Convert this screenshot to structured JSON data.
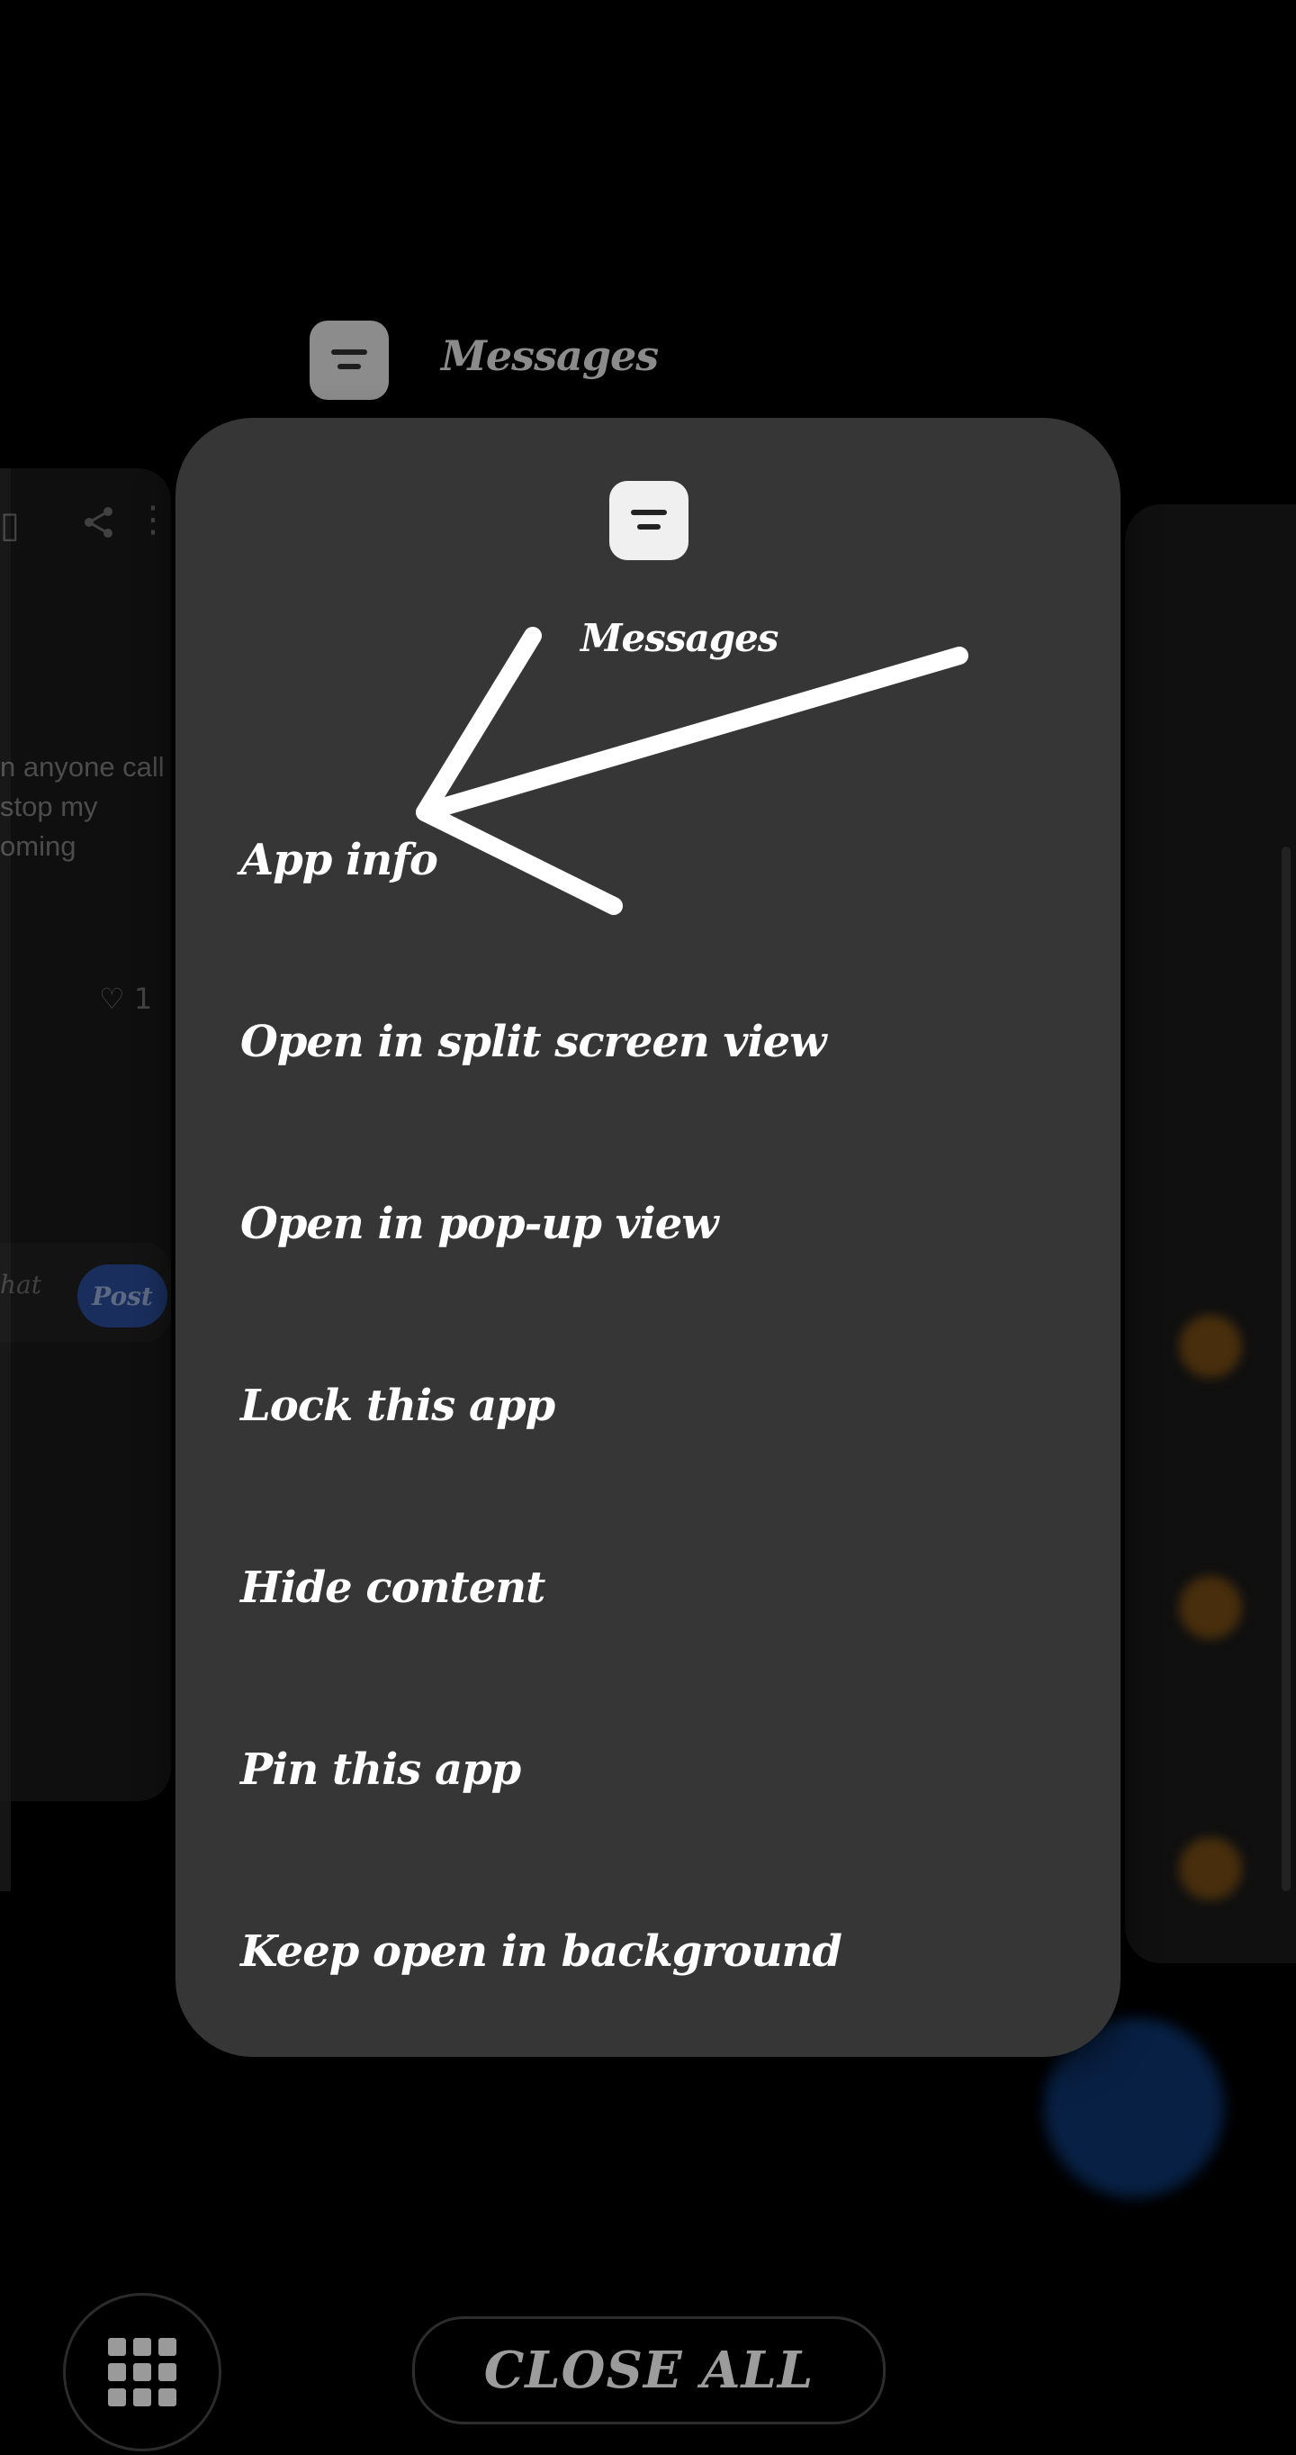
{
  "background_cards": {
    "left": {
      "snippet_lines": [
        "n anyone call",
        "stop my",
        "oming"
      ],
      "likes_count": "1",
      "compose_placeholder": "hat",
      "post_label": "Post"
    }
  },
  "card_header": {
    "app_name": "Messages",
    "icon": "messages-app-icon"
  },
  "menu": {
    "app_name": "Messages",
    "icon": "messages-app-icon",
    "items": [
      {
        "label": "App info"
      },
      {
        "label": "Open in split screen view"
      },
      {
        "label": "Open in pop-up view"
      },
      {
        "label": "Lock this app"
      },
      {
        "label": "Hide content"
      },
      {
        "label": "Pin this app"
      },
      {
        "label": "Keep open in background"
      }
    ]
  },
  "annotation": {
    "type": "hand-drawn-arrow",
    "color": "#ffffff",
    "points_to": "App info"
  },
  "bottom_bar": {
    "apps_icon": "app-grid-icon",
    "close_all_label": "CLOSE ALL"
  },
  "colors": {
    "menu_background": "#363636",
    "screen_background": "#000000",
    "post_button": "#2e55a8"
  }
}
